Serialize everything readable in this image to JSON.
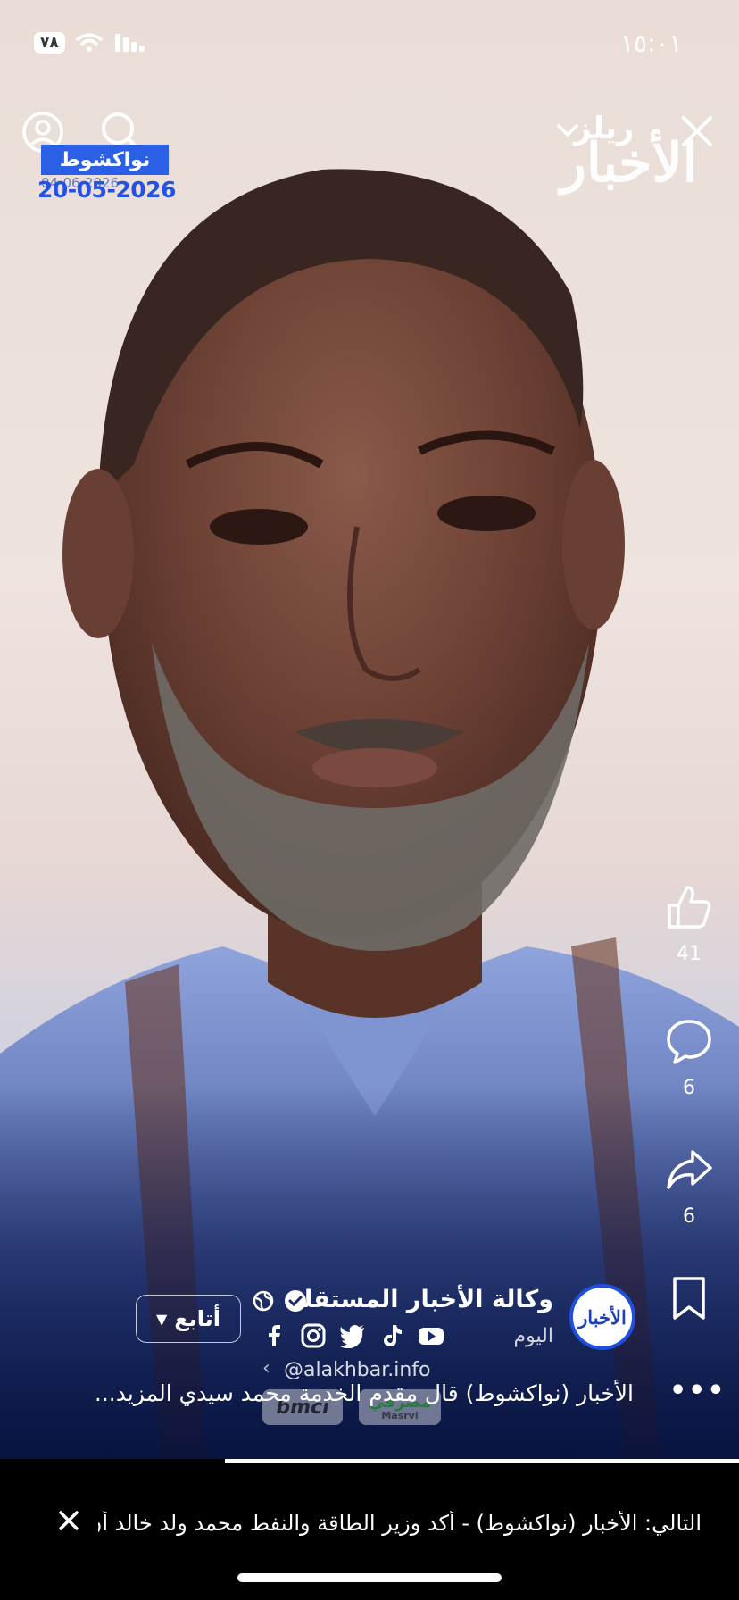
{
  "status_bar": {
    "time": "١٥:٠١",
    "battery": "٧٨"
  },
  "header": {
    "reels_label": "ريلز",
    "watermark": "الأخبار"
  },
  "overlay": {
    "location": "نواكشوط",
    "date": "20-05-2026",
    "date_ghost": "04-06-2026"
  },
  "actions": {
    "likes": "41",
    "comments": "6",
    "shares": "6"
  },
  "post": {
    "page_name": "وكالة الأخبار المستقلة",
    "timestamp": "اليوم",
    "follow_label": "أتابع",
    "avatar_text": "الأخبار",
    "handle": "@alakhbar.info",
    "caption": "الأخبار (نواكشوط) قال مقدم الخدمة محمد سيدي المزيد...",
    "sponsor1": "bmci",
    "sponsor2": "مصرفي",
    "sponsor2_sub": "Masrvi"
  },
  "up_next": "التالي: الأخبار (نواكشوط) - أكد وزير الطاقة والنفط محمد ولد خالد أن ا...",
  "colors": {
    "accent_blue": "#2a5fe6",
    "background": "#000000"
  },
  "icons": [
    "user-circle-icon",
    "search-icon",
    "chevron-down-icon",
    "close-icon",
    "thumbs-up-icon",
    "comment-icon",
    "share-icon",
    "bookmark-icon",
    "globe-icon",
    "verified-icon",
    "facebook-icon",
    "instagram-icon",
    "twitter-icon",
    "tiktok-icon",
    "youtube-icon",
    "more-icon"
  ]
}
